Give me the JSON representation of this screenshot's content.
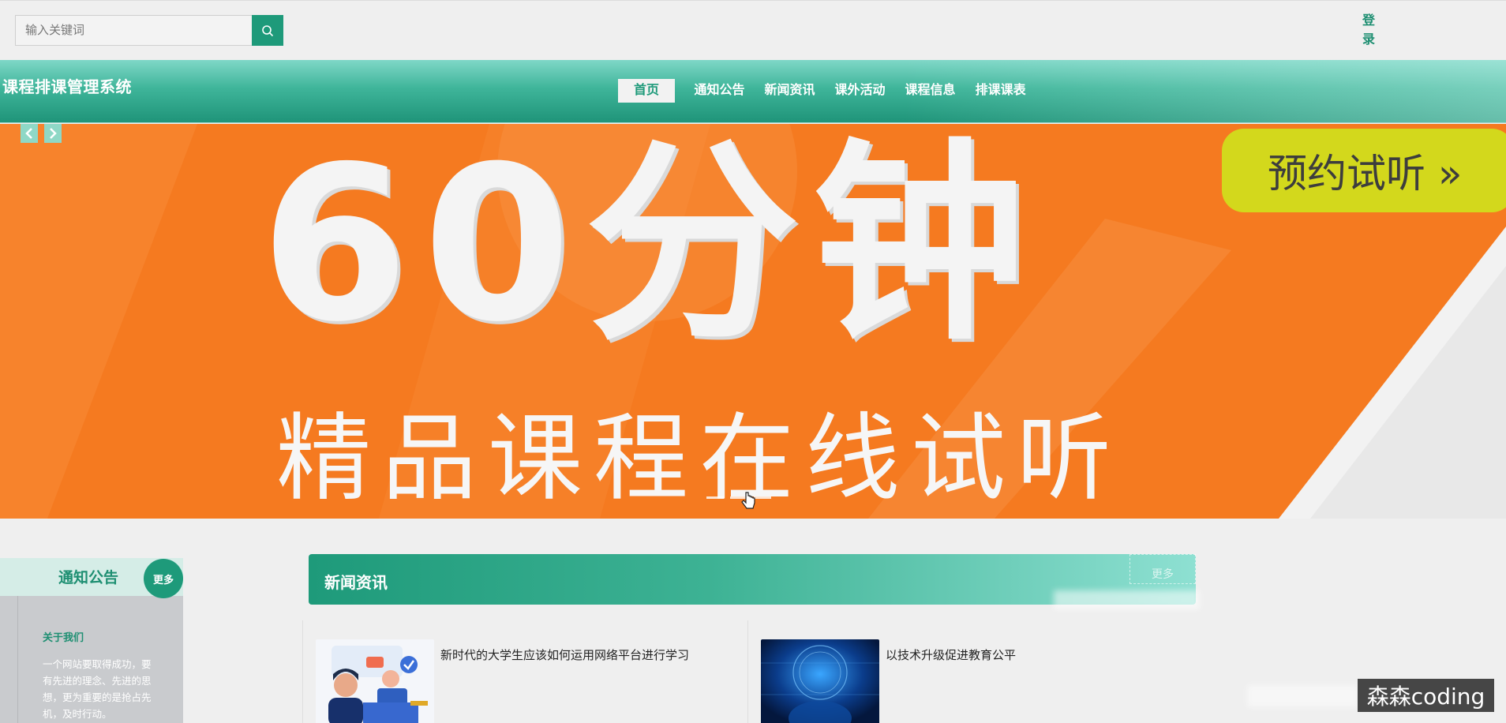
{
  "search": {
    "placeholder": "输入关键词"
  },
  "login": {
    "label": "登录"
  },
  "header": {
    "site_title": "课程排课管理系统"
  },
  "nav": {
    "items": [
      {
        "label": "首页",
        "active": true
      },
      {
        "label": "通知公告"
      },
      {
        "label": "新闻资讯"
      },
      {
        "label": "课外活动"
      },
      {
        "label": "课程信息"
      },
      {
        "label": "排课课表"
      }
    ]
  },
  "banner": {
    "headline": "60分钟",
    "subline": "精品课程在线试听",
    "cta": "预约试听 »",
    "slide_count": 3
  },
  "notice": {
    "title": "通知公告",
    "more": "更多",
    "about_title": "关于我们",
    "about_text": "一个网站要取得成功，要有先进的理念、先进的思想，更为重要的是抢占先机，及时行动。"
  },
  "news": {
    "title": "新闻资讯",
    "more": "更多",
    "items": [
      {
        "title": "新时代的大学生应该如何运用网络平台进行学习"
      },
      {
        "title": "以技术升级促进教育公平"
      }
    ]
  },
  "watermark": {
    "text": "森森coding"
  },
  "colors": {
    "primary": "#1e9a7a",
    "banner_orange": "#f57a20",
    "cta_yellow": "#d3d81c"
  }
}
